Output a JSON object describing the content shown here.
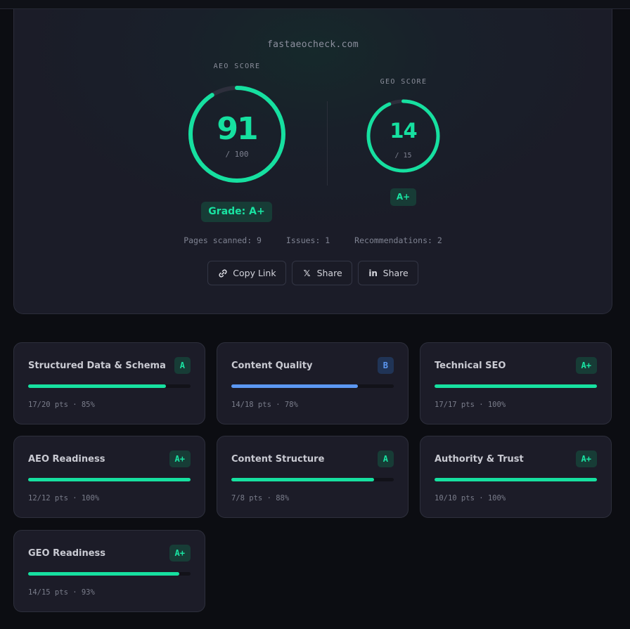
{
  "hero": {
    "domain": "fastaeocheck.com",
    "aeo": {
      "label": "AEO SCORE",
      "score": "91",
      "max_label": "/ 100",
      "value": 91,
      "max": 100,
      "color": "#16e0a0"
    },
    "geo": {
      "label": "GEO SCORE",
      "score": "14",
      "max_label": "/ 15",
      "value": 14,
      "max": 15,
      "color": "#16e0a0",
      "grade": "A+"
    },
    "grade": "Grade: A+",
    "stats": {
      "pages": "Pages scanned: 9",
      "issues": "Issues: 1",
      "recommendations": "Recommendations: 2"
    },
    "share": {
      "copy_label": "Copy Link",
      "copy_icon": "link-icon",
      "x_label": "Share",
      "x_icon": "x-logo-icon",
      "linkedin_label": "Share",
      "linkedin_icon": "linkedin-icon"
    }
  },
  "colors": {
    "accent": "#16e0a0",
    "blue": "#5c98f3",
    "track": "#2d2f3c"
  },
  "categories": [
    {
      "title": "Structured Data & Schema",
      "grade": "A",
      "pts": "17/20 pts · 85%",
      "percent": 85,
      "color": "green"
    },
    {
      "title": "Content Quality",
      "grade": "B",
      "pts": "14/18 pts · 78%",
      "percent": 78,
      "color": "blue"
    },
    {
      "title": "Technical SEO",
      "grade": "A+",
      "pts": "17/17 pts · 100%",
      "percent": 100,
      "color": "green"
    },
    {
      "title": "AEO Readiness",
      "grade": "A+",
      "pts": "12/12 pts · 100%",
      "percent": 100,
      "color": "green"
    },
    {
      "title": "Content Structure",
      "grade": "A",
      "pts": "7/8 pts · 88%",
      "percent": 88,
      "color": "green"
    },
    {
      "title": "Authority & Trust",
      "grade": "A+",
      "pts": "10/10 pts · 100%",
      "percent": 100,
      "color": "green"
    },
    {
      "title": "GEO Readiness",
      "grade": "A+",
      "pts": "14/15 pts · 93%",
      "percent": 93,
      "color": "green"
    }
  ]
}
